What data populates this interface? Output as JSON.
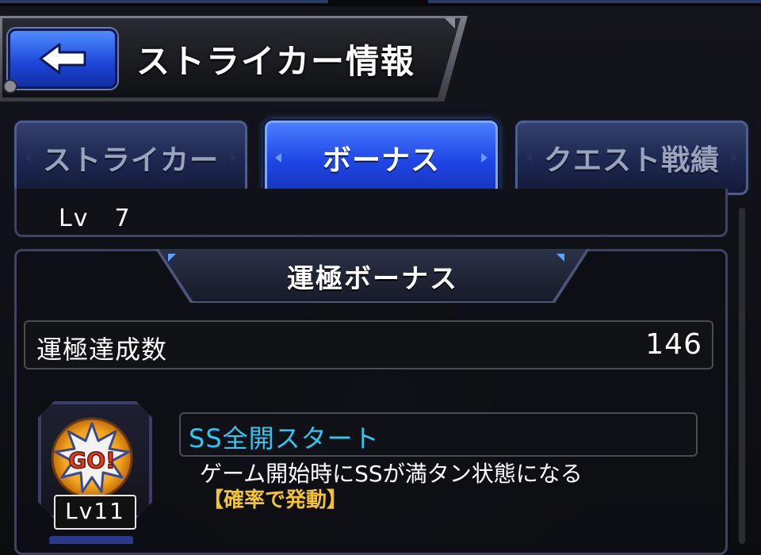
{
  "header": {
    "title": "ストライカー情報"
  },
  "tabs": [
    {
      "label": "ストライカー",
      "active": false
    },
    {
      "label": "ボーナス",
      "active": true
    },
    {
      "label": "クエスト戦績",
      "active": false
    }
  ],
  "level": {
    "text": "Lv　7"
  },
  "bonus": {
    "title": "運極ボーナス",
    "count_label": "運極達成数",
    "count_value": "146",
    "ability": {
      "icon": "go-burst-icon",
      "icon_text": "GO!",
      "level": "Lv11",
      "name": "SS全開スタート",
      "description": "ゲーム開始時にSSが満タン状態になる",
      "note": "【確率で発動】"
    }
  },
  "colors": {
    "accent_blue": "#1f46e6",
    "ability_name": "#2ec6f2",
    "note_yellow": "#f3c237"
  }
}
